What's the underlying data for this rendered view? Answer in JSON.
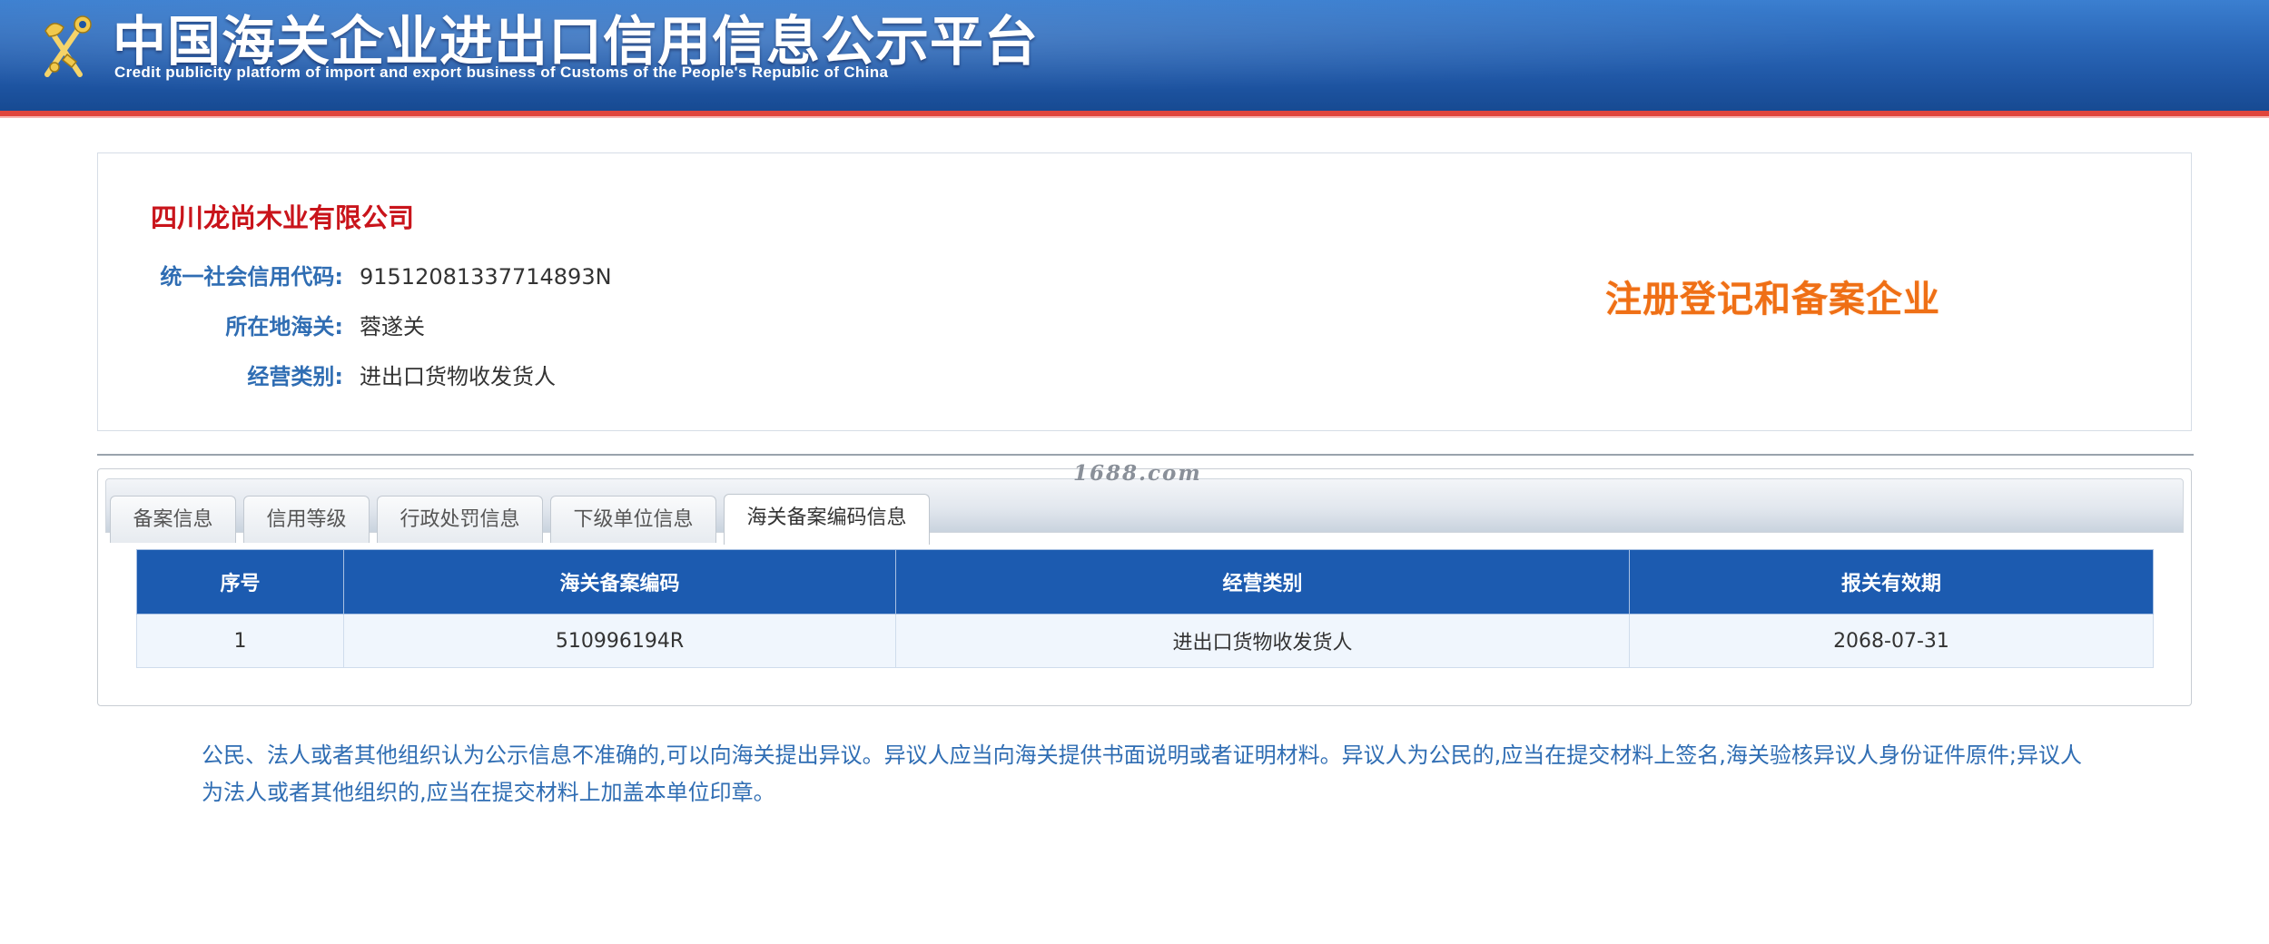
{
  "header": {
    "title": "中国海关企业进出口信用信息公示平台",
    "subtitle": "Credit publicity platform of import and export business of Customs of the People's Republic of China"
  },
  "company": {
    "name": "四川龙尚木业有限公司",
    "fields": [
      {
        "label": "统一社会信用代码:",
        "value": "91512081337714893N"
      },
      {
        "label": "所在地海关:",
        "value": "蓉遂关"
      },
      {
        "label": "经营类别:",
        "value": "进出口货物收发货人"
      }
    ],
    "status_badge": "注册登记和备案企业"
  },
  "watermark": "1688.com",
  "tabs": [
    {
      "label": "备案信息"
    },
    {
      "label": "信用等级"
    },
    {
      "label": "行政处罚信息"
    },
    {
      "label": "下级单位信息"
    },
    {
      "label": "海关备案编码信息"
    }
  ],
  "table": {
    "columns": [
      "序号",
      "海关备案编码",
      "经营类别",
      "报关有效期"
    ],
    "rows": [
      [
        "1",
        "510996194R",
        "进出口货物收发货人",
        "2068-07-31"
      ]
    ]
  },
  "notice": "公民、法人或者其他组织认为公示信息不准确的,可以向海关提出异议。异议人应当向海关提供书面说明或者证明材料。异议人为公民的,应当在提交材料上签名,海关验核异议人身份证件原件;异议人为法人或者其他组织的,应当在提交材料上加盖本单位印章。",
  "colors": {
    "header_blue": "#1e55a3",
    "accent_red": "#c9141b",
    "label_blue": "#2f6db3",
    "badge_orange": "#ef6f15",
    "table_header": "#1c5bb0"
  },
  "icons": {
    "emblem": "customs-emblem-icon"
  }
}
